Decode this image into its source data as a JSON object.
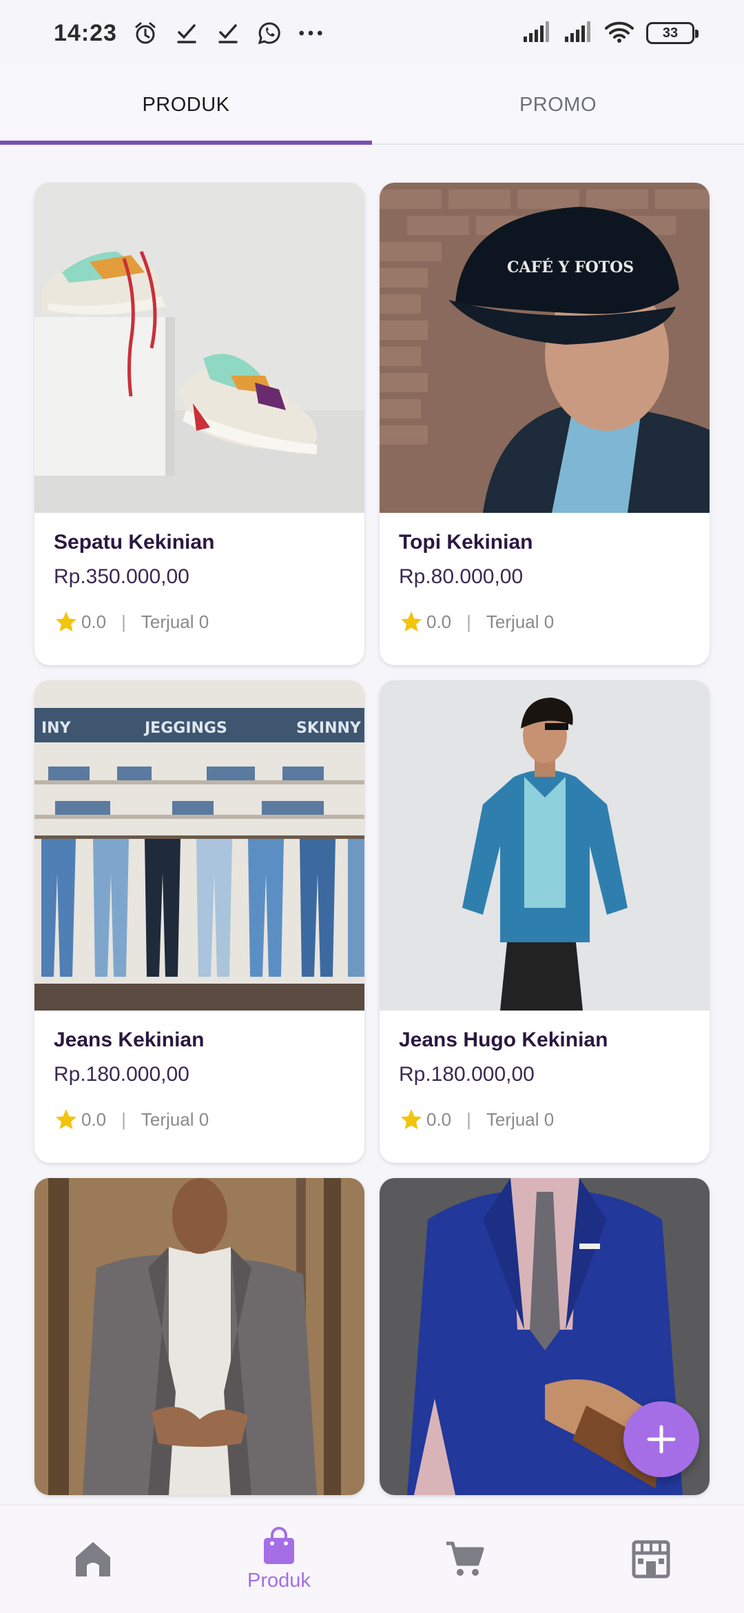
{
  "status_bar": {
    "time": "14:23",
    "battery": "33",
    "icons": [
      "alarm-icon",
      "check-icon",
      "check-icon",
      "whatsapp-icon",
      "more-dots-icon",
      "signal-icon",
      "signal-icon",
      "wifi-icon",
      "battery-icon"
    ]
  },
  "tabs": [
    {
      "label": "PRODUK",
      "active": true
    },
    {
      "label": "PROMO",
      "active": false
    }
  ],
  "products": [
    {
      "name": "Sepatu Kekinian",
      "price": "Rp.350.000,00",
      "rating": "0.0",
      "sold": "Terjual 0",
      "image": "sneakers-photo"
    },
    {
      "name": "Topi Kekinian",
      "price": "Rp.80.000,00",
      "rating": "0.0",
      "sold": "Terjual 0",
      "image": "cap-photo"
    },
    {
      "name": "Jeans Kekinian",
      "price": "Rp.180.000,00",
      "rating": "0.0",
      "sold": "Terjual 0",
      "image": "jeans-rack-photo"
    },
    {
      "name": "Jeans Hugo Kekinian",
      "price": "Rp.180.000,00",
      "rating": "0.0",
      "sold": "Terjual 0",
      "image": "denim-jacket-photo"
    },
    {
      "image": "blazer-photo"
    },
    {
      "image": "suit-photo"
    }
  ],
  "fab": {
    "icon": "plus-icon"
  },
  "bottom_nav": [
    {
      "icon": "home-icon",
      "label": "",
      "active": false
    },
    {
      "icon": "shopping-bag-icon",
      "label": "Produk",
      "active": true
    },
    {
      "icon": "cart-icon",
      "label": "",
      "active": false
    },
    {
      "icon": "store-icon",
      "label": "",
      "active": false
    }
  ],
  "colors": {
    "accent": "#a56ee6",
    "tab_indicator": "#7a4fb0",
    "star": "#f2c40f",
    "nav_inactive": "#7d7d86"
  }
}
